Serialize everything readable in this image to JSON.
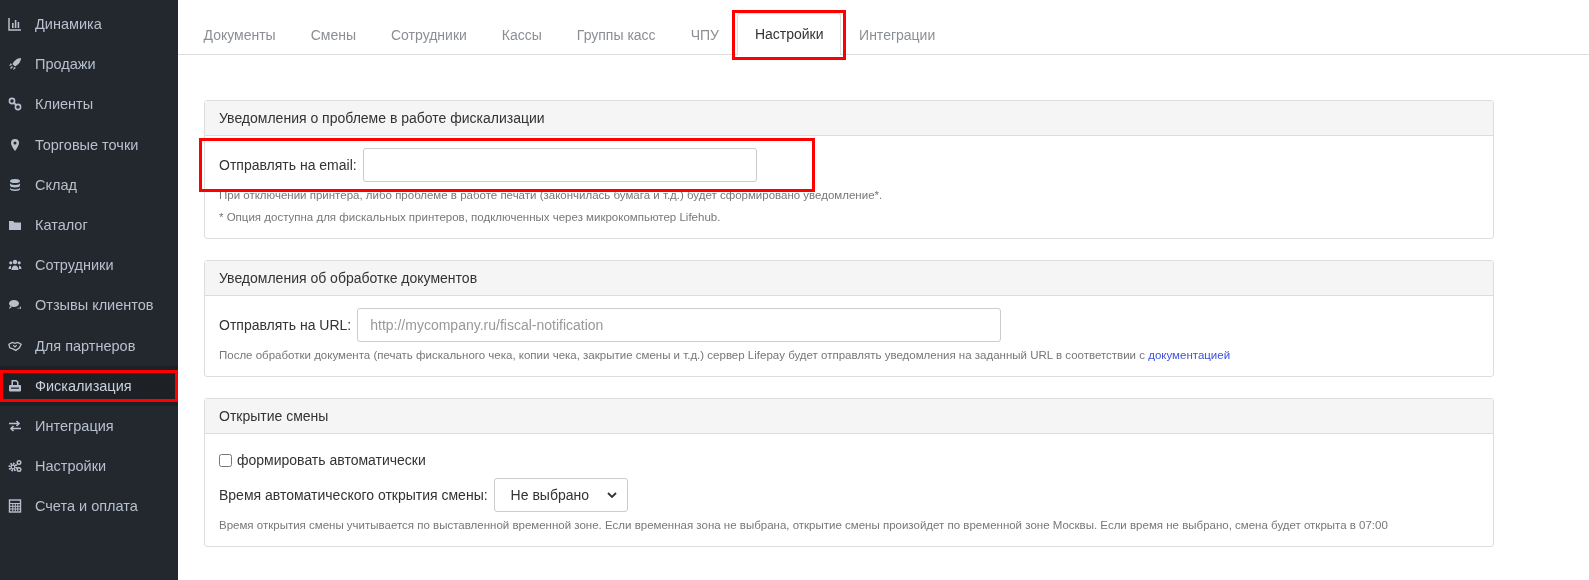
{
  "sidebar": {
    "items": [
      {
        "label": "Динамика",
        "selected": false,
        "highlighted": false
      },
      {
        "label": "Продажи",
        "selected": false,
        "highlighted": false
      },
      {
        "label": "Клиенты",
        "selected": false,
        "highlighted": false
      },
      {
        "label": "Торговые точки",
        "selected": false,
        "highlighted": false
      },
      {
        "label": "Склад",
        "selected": false,
        "highlighted": false
      },
      {
        "label": "Каталог",
        "selected": false,
        "highlighted": false
      },
      {
        "label": "Сотрудники",
        "selected": false,
        "highlighted": false
      },
      {
        "label": "Отзывы клиентов",
        "selected": false,
        "highlighted": false
      },
      {
        "label": "Для партнеров",
        "selected": false,
        "highlighted": false
      },
      {
        "label": "Фискализация",
        "selected": true,
        "highlighted": true
      },
      {
        "label": "Интеграция",
        "selected": false,
        "highlighted": false
      },
      {
        "label": "Настройки",
        "selected": false,
        "highlighted": false
      },
      {
        "label": "Счета и оплата",
        "selected": false,
        "highlighted": false
      }
    ]
  },
  "tabs": [
    {
      "label": "Документы",
      "selected": false,
      "highlighted": false
    },
    {
      "label": "Смены",
      "selected": false,
      "highlighted": false
    },
    {
      "label": "Сотрудники",
      "selected": false,
      "highlighted": false
    },
    {
      "label": "Кассы",
      "selected": false,
      "highlighted": false
    },
    {
      "label": "Группы касс",
      "selected": false,
      "highlighted": false
    },
    {
      "label": "ЧПУ",
      "selected": false,
      "highlighted": false
    },
    {
      "label": "Настройки",
      "selected": true,
      "highlighted": true
    },
    {
      "label": "Интеграции",
      "selected": false,
      "highlighted": false
    }
  ],
  "panels": [
    {
      "title": "Уведомления о проблеме в работе фискализации",
      "fields": [
        {
          "kind": "text",
          "label": "Отправлять на email:",
          "highlighted": true,
          "help": [
            "При отключении принтера, либо проблеме в работе печати (закончилась бумага и т.д.) будет сформировано уведомление*.",
            "* Опция доступна для фискальных принтеров, подключенных через микрокомпьютер Lifehub."
          ]
        }
      ]
    },
    {
      "title": "Уведомления об обработке документов",
      "fields": [
        {
          "kind": "text",
          "label": "Отправлять на URL:",
          "placeholder": "http://mycompany.ru/fiscal-notification",
          "help": [
            "После обработки документа (печать фискального чека, копии чека, закрытие смены и т.д.) сервер Lifepay будет отправлять уведомления на заданный URL в соответствии с"
          ],
          "link": "документацией"
        }
      ]
    },
    {
      "title": "Открытие смены",
      "fields": [
        {
          "kind": "checkbox",
          "label": "формировать автоматически",
          "checked": false
        },
        {
          "kind": "select",
          "label": "Время автоматического открытия смены:",
          "value": "Не выбрано",
          "help": [
            "Время открытия смены учитывается по выставленной временной зоне. Если временная зона не выбрана, открытие смены произойдет по временной зоне Москвы. Если время не выбрано, смена будет открыта в 07:00"
          ]
        }
      ]
    }
  ]
}
